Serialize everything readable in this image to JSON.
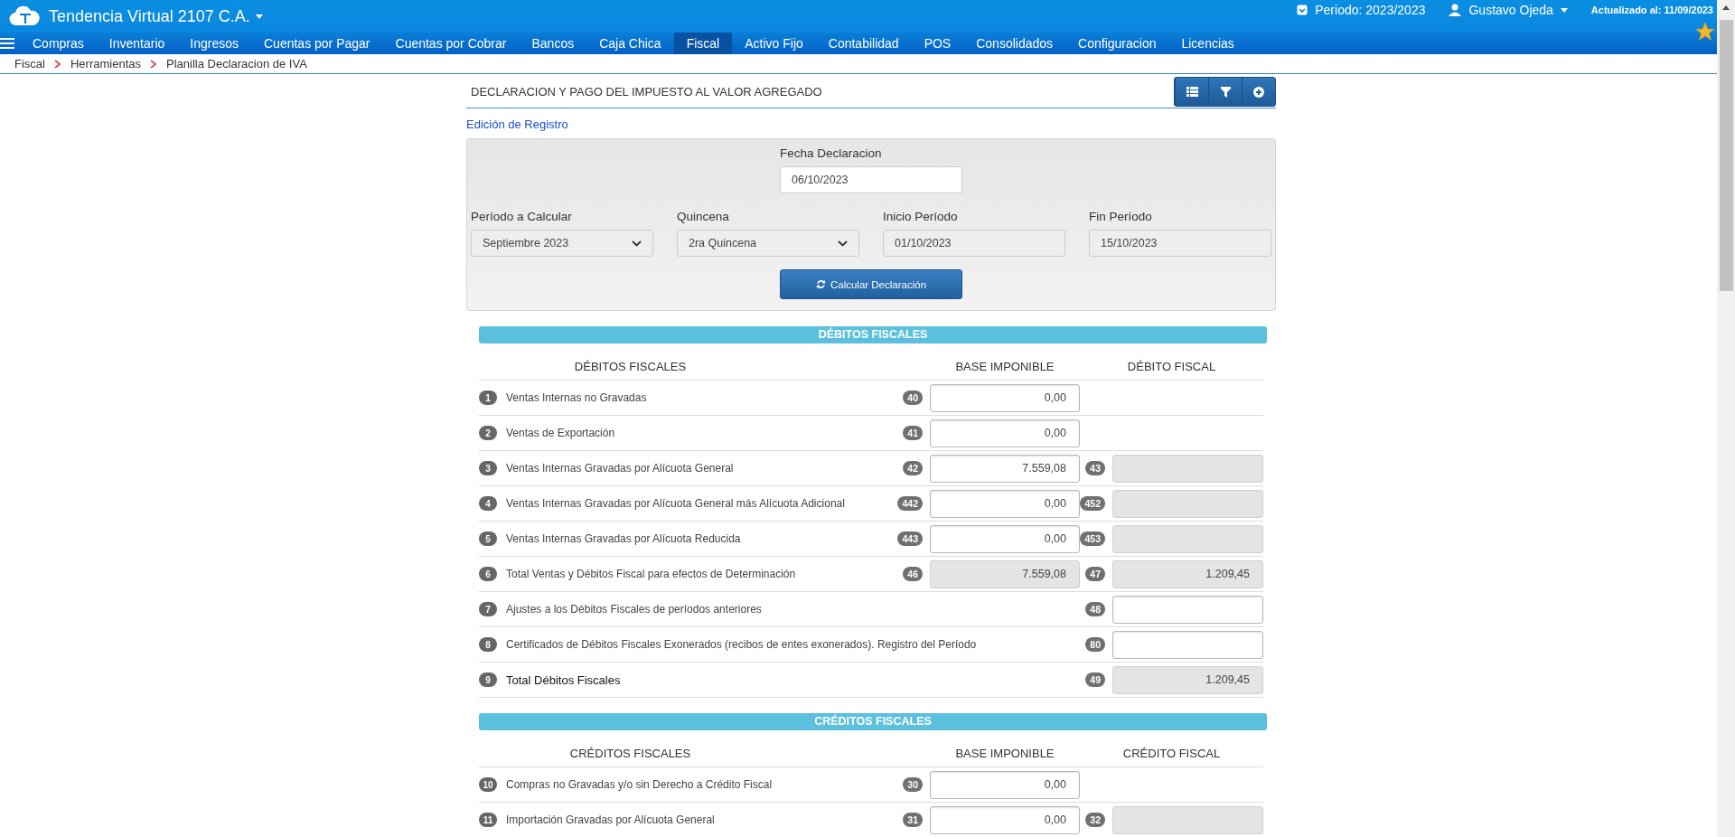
{
  "app": {
    "title": "Tendencia Virtual 2107 C.A.",
    "period": "Periodo: 2023/2023",
    "user": "Gustavo Ojeda",
    "updated": "Actualizado al: 11/09/2023"
  },
  "nav": [
    {
      "label": "Compras",
      "selected": false
    },
    {
      "label": "Inventario",
      "selected": false
    },
    {
      "label": "Ingresos",
      "selected": false
    },
    {
      "label": "Cuentas por Pagar",
      "selected": false
    },
    {
      "label": "Cuentas por Cobrar",
      "selected": false
    },
    {
      "label": "Bancos",
      "selected": false
    },
    {
      "label": "Caja Chica",
      "selected": false
    },
    {
      "label": "Fiscal",
      "selected": true
    },
    {
      "label": "Activo Fijo",
      "selected": false
    },
    {
      "label": "Contabilidad",
      "selected": false
    },
    {
      "label": "POS",
      "selected": false
    },
    {
      "label": "Consolidados",
      "selected": false
    },
    {
      "label": "Configuracion",
      "selected": false
    },
    {
      "label": "Licencias",
      "selected": false
    }
  ],
  "breadcrumb": [
    "Fiscal",
    "Herramientas",
    "Planilla Declaracion de IVA"
  ],
  "panel": {
    "title": "DECLARACION Y PAGO DEL IMPUESTO AL VALOR AGREGADO",
    "subtitle": "Edición de Registro"
  },
  "form": {
    "date_label": "Fecha Declaracion",
    "date_value": "06/10/2023",
    "fields": [
      {
        "kind": "select",
        "label": "Período a Calcular",
        "value": "Septiembre 2023"
      },
      {
        "kind": "select",
        "label": "Quincena",
        "value": "2ra Quincena"
      },
      {
        "kind": "readonly",
        "label": "Inicio Período",
        "value": "01/10/2023"
      },
      {
        "kind": "readonly",
        "label": "Fin Período",
        "value": "15/10/2023"
      }
    ],
    "button": "Calcular Declaración"
  },
  "sections": [
    {
      "title": "DÉBITOS FISCALES",
      "columns": [
        "DÉBITOS FISCALES",
        "BASE IMPONIBLE",
        "DÉBITO FISCAL"
      ],
      "rows": [
        {
          "num": "1",
          "label": "Ventas Internas no Gravadas",
          "total": false,
          "base": {
            "code": "40",
            "value": "0,00",
            "readonly": false
          }
        },
        {
          "num": "2",
          "label": "Ventas de Exportación",
          "total": false,
          "base": {
            "code": "41",
            "value": "0,00",
            "readonly": false
          }
        },
        {
          "num": "3",
          "label": "Ventas Internas Gravadas por Alícuota General",
          "total": false,
          "base": {
            "code": "42",
            "value": "7.559,08",
            "readonly": false
          },
          "tax": {
            "code": "43",
            "readonly": true
          }
        },
        {
          "num": "4",
          "label": "Ventas Internas Gravadas por Alícuota General más Alícuota Adicional",
          "total": false,
          "base": {
            "code": "442",
            "value": "0,00",
            "readonly": false
          },
          "tax": {
            "code": "452",
            "readonly": true
          }
        },
        {
          "num": "5",
          "label": "Ventas Internas Gravadas por Alícuota Reducida",
          "total": false,
          "base": {
            "code": "443",
            "value": "0,00",
            "readonly": false
          },
          "tax": {
            "code": "453",
            "readonly": true
          }
        },
        {
          "num": "6",
          "label": "Total Ventas y Débitos Fiscal para efectos de Determinación",
          "total": false,
          "base": {
            "code": "46",
            "value": "7.559,08",
            "readonly": true
          },
          "tax": {
            "code": "47",
            "value": "1.209,45",
            "readonly": true
          }
        },
        {
          "num": "7",
          "label": "Ajustes a los Débitos Fiscales de períodos anteriores",
          "total": false,
          "tax": {
            "code": "48",
            "readonly": false
          }
        },
        {
          "num": "8",
          "label": "Certificados de Débitos Fiscales Exonerados (recibos de entes exonerados). Registro del Período",
          "total": false,
          "tax": {
            "code": "80",
            "readonly": false
          }
        },
        {
          "num": "9",
          "label": "Total Débitos Fiscales",
          "total": true,
          "tax": {
            "code": "49",
            "value": "1.209,45",
            "readonly": true
          }
        }
      ]
    },
    {
      "title": "CRÉDITOS FISCALES",
      "columns": [
        "CRÉDITOS FISCALES",
        "BASE IMPONIBLE",
        "CRÉDITO FISCAL"
      ],
      "rows": [
        {
          "num": "10",
          "label": "Compras no Gravadas y/o sin Derecho a Crédito Fiscal",
          "total": false,
          "base": {
            "code": "30",
            "value": "0,00",
            "readonly": false
          }
        },
        {
          "num": "11",
          "label": "Importación Gravadas por Alícuota General",
          "total": false,
          "base": {
            "code": "31",
            "value": "0,00",
            "readonly": false
          },
          "tax": {
            "code": "32",
            "readonly": true
          }
        }
      ]
    }
  ]
}
